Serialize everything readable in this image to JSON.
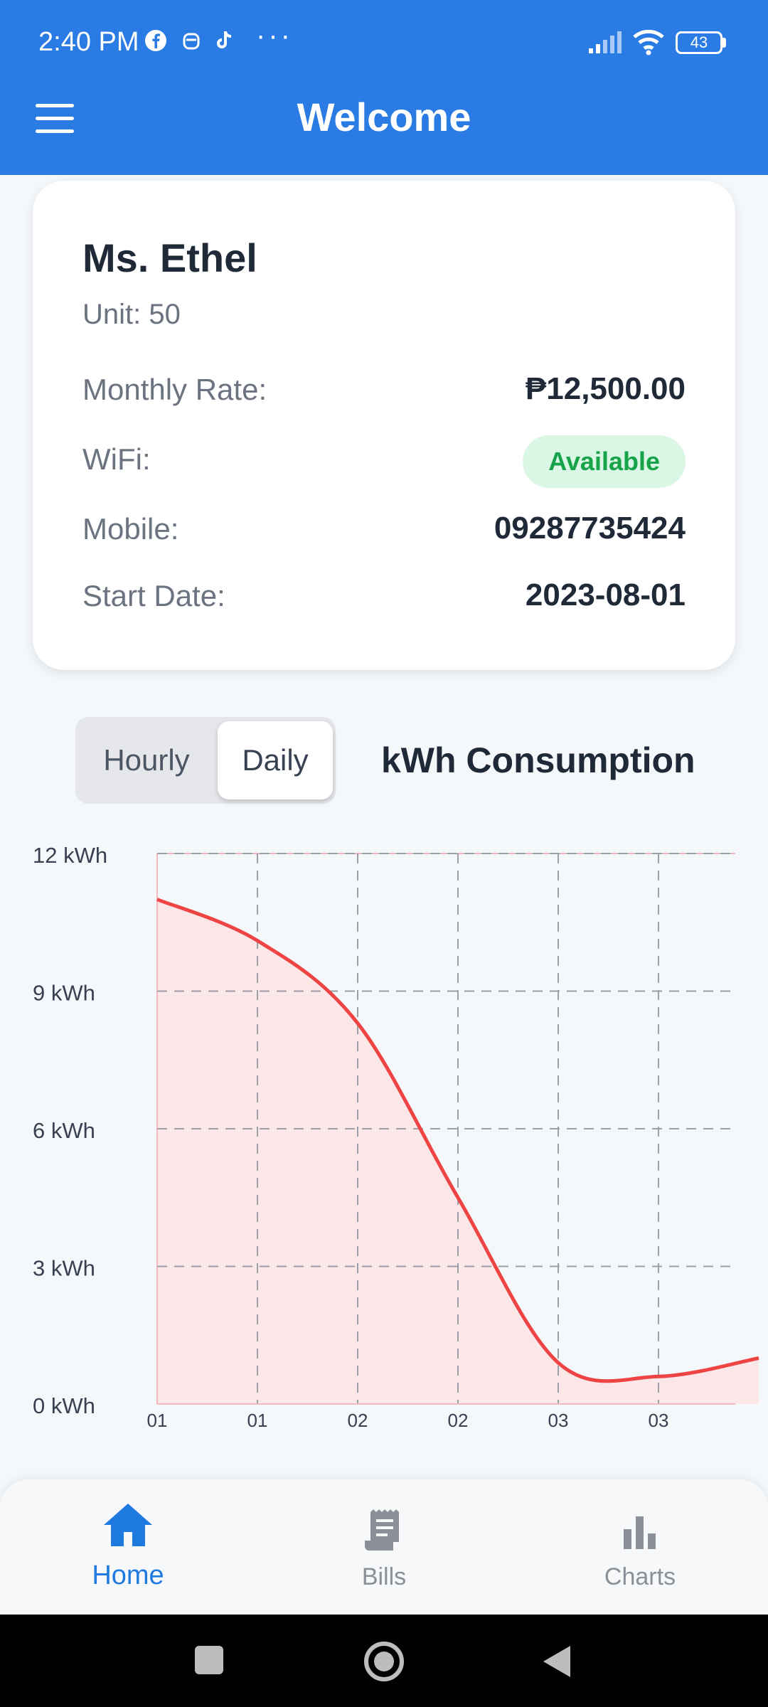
{
  "status_bar": {
    "time": "2:40 PM",
    "battery": "43"
  },
  "app_bar": {
    "title": "Welcome"
  },
  "tenant": {
    "name": "Ms. Ethel",
    "unit": "Unit: 50",
    "rows": [
      {
        "label": "Monthly Rate:",
        "value": "₱12,500.00"
      },
      {
        "label": "WiFi:",
        "value": "Available"
      },
      {
        "label": "Mobile:",
        "value": "09287735424"
      },
      {
        "label": "Start Date:",
        "value": "2023-08-01"
      }
    ]
  },
  "toggle": {
    "hourly": "Hourly",
    "daily": "Daily",
    "selected": "Daily"
  },
  "chart_title": "kWh Consumption",
  "chart_data": {
    "type": "area",
    "x": [
      "01",
      "01",
      "02",
      "02",
      "03",
      "03"
    ],
    "y_ticks": [
      "0 kWh",
      "3 kWh",
      "6 kWh",
      "9 kWh",
      "12 kWh"
    ],
    "ylim": [
      0,
      12
    ],
    "series": [
      {
        "values": [
          11.0,
          10.1,
          8.3,
          4.5,
          0.9,
          0.6,
          1.0
        ]
      }
    ],
    "color": "#ef4444",
    "grid": true
  },
  "bottom_nav": {
    "home": "Home",
    "bills": "Bills",
    "charts": "Charts"
  },
  "colors": {
    "primary": "#2a7be3",
    "accent": "#1f7ae0",
    "success": "#16a34a"
  }
}
